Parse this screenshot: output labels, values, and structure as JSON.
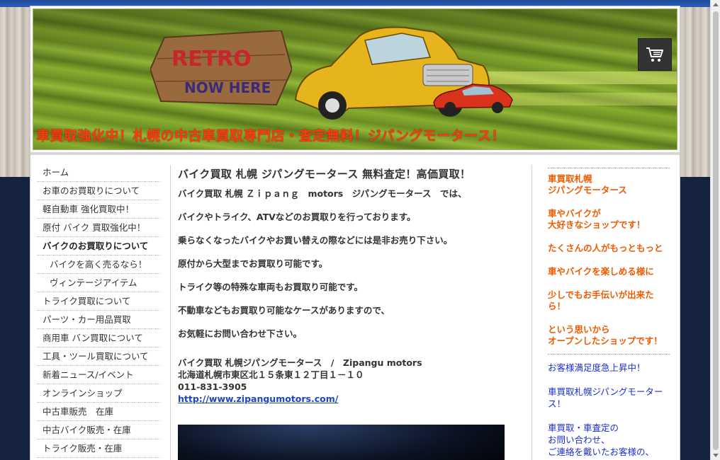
{
  "header": {
    "banner_title": "車買取強化中！札幌の中古車買取専門店・査定無料！ジパングモータース！",
    "banner_sign_line1": "RETRO",
    "banner_sign_line2": "NOW HERE",
    "cart_icon": "shopping-cart-icon"
  },
  "nav": {
    "items": [
      {
        "label": "ホーム"
      },
      {
        "label": "お車のお買取りについて"
      },
      {
        "label": "軽自動車 強化買取中！"
      },
      {
        "label": "原付 バイク 買取強化中！"
      },
      {
        "label": "バイクのお買取りについて"
      },
      {
        "label": "バイクを高く売るなら！"
      },
      {
        "label": "ヴィンテージアイテム"
      },
      {
        "label": "トライク買取について"
      },
      {
        "label": "パーツ・カー用品買取"
      },
      {
        "label": "商用車 バン買取について"
      },
      {
        "label": "工具・ツール買取について"
      },
      {
        "label": "新着ニュース/イベント"
      },
      {
        "label": "オンラインショップ"
      },
      {
        "label": "中古車販売　在庫"
      },
      {
        "label": "中古バイク販売・在庫"
      },
      {
        "label": "トライク販売・在庫"
      }
    ]
  },
  "main": {
    "title": "バイク買取 札幌 ジパングモータース 無料査定！高価買取！",
    "paragraphs": [
      "バイク買取 札幌 Ｚｉｐａｎｇ　motors　ジパングモータース　では、",
      "バイクやトライク、ATVなどのお買取りを行っております。",
      "乗らなくなったバイクやお買い替えの際などには是非お売り下さい。",
      "原付から大型までお買取り可能です。",
      "トライク等の特殊な車両もお買取り可能です。",
      "不動車などもお買取り可能なケースがありますので、",
      "お気軽にお問い合わせ下さい。"
    ],
    "address": {
      "line1": "バイク買取 札幌ジパングモータース　/　Zipangu motors",
      "line2": "北海道札幌市東区北１５条東１２丁目１－１０",
      "phone": "011-831-3905",
      "url": "http://www.zipangumotors.com/"
    }
  },
  "side": {
    "orange": [
      [
        "車買取札幌",
        "ジパングモータース"
      ],
      [
        "車やバイクが",
        "大好きなショップです！"
      ],
      [
        "たくさんの人がもっともっと"
      ],
      [
        "車やバイクを楽しめる様に"
      ],
      [
        "少しでもお手伝いが出来たら！"
      ],
      [
        "という思いから",
        "オープンしたショップです！"
      ]
    ],
    "blue": [
      [
        "お客様満足度急上昇中！"
      ],
      [
        "車買取札幌ジパングモーター",
        "ス！"
      ],
      [
        "車買取・車査定の",
        "お問い合わせ、",
        "ご連絡を戴いたお客様の、"
      ]
    ]
  },
  "colors": {
    "accent_orange": "#f05a00",
    "link_blue": "#1a2fd0",
    "banner_red": "#ff3a10"
  }
}
